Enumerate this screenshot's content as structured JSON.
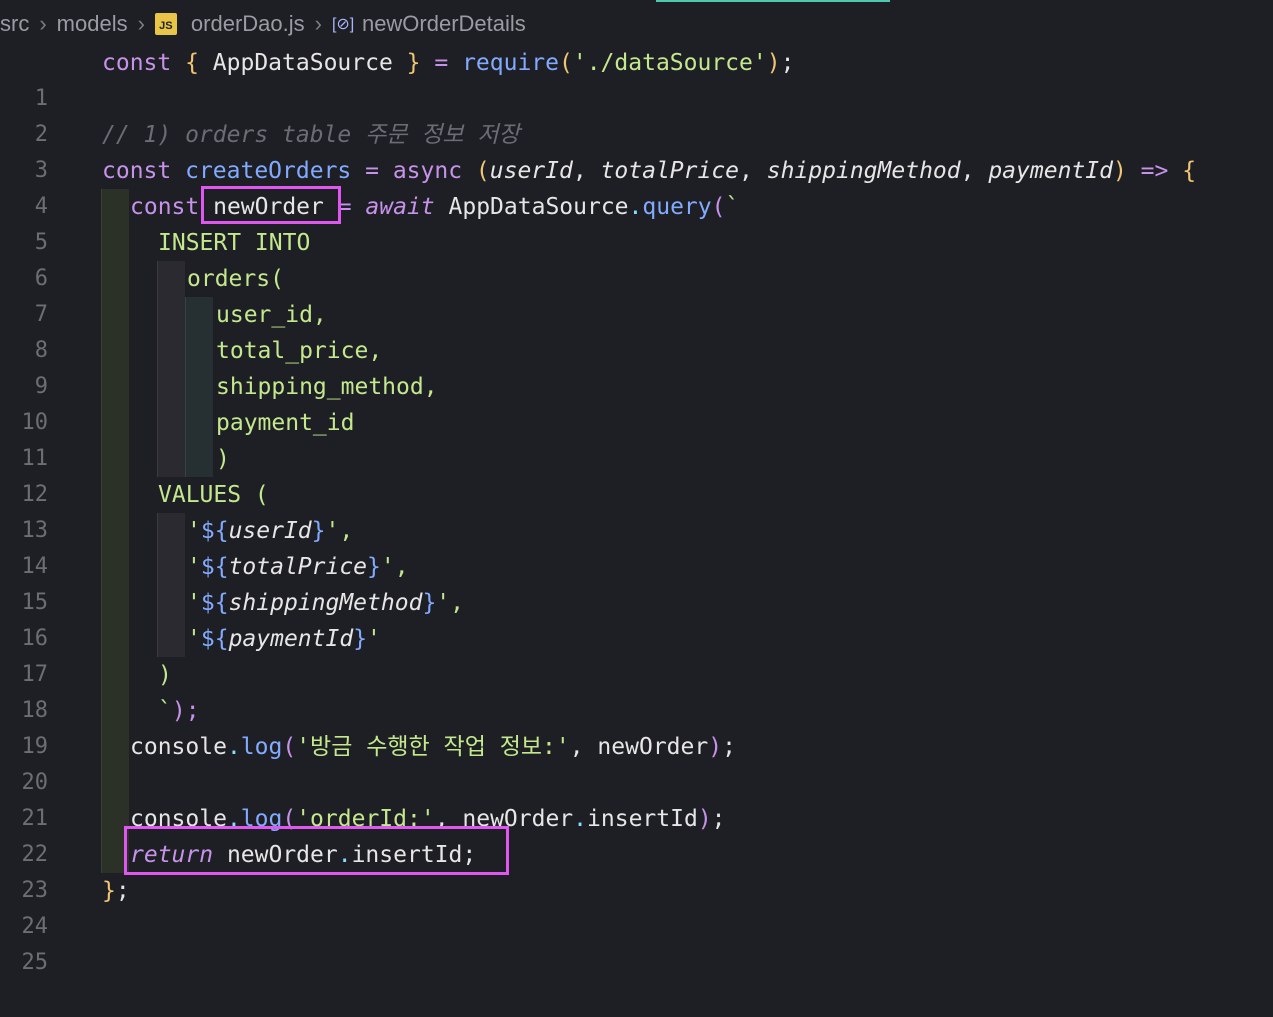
{
  "breadcrumb": {
    "items": [
      "src",
      "models",
      "orderDao.js",
      "newOrderDetails"
    ],
    "file_icon_text": "JS"
  },
  "code": {
    "line_numbers": [
      "1",
      "2",
      "3",
      "4",
      "5",
      "6",
      "7",
      "8",
      "9",
      "10",
      "11",
      "12",
      "13",
      "14",
      "15",
      "16",
      "17",
      "18",
      "19",
      "20",
      "21",
      "22",
      "23",
      "24",
      "25"
    ],
    "l1": {
      "a": "const ",
      "b": "{ ",
      "c": "AppDataSource",
      "d": " }",
      "e": " = ",
      "f": "require",
      "g": "(",
      "h": "'./dataSource'",
      "i": ")",
      "j": ";"
    },
    "l3": "// 1) orders table 주문 정보 저장",
    "l4": {
      "a": "const ",
      "b": "createOrders",
      "c": " = ",
      "d": "async ",
      "e": "(",
      "f": "userId",
      ",": ", ",
      "g": "totalPrice",
      "h": "shippingMethod",
      "i": "paymentId",
      "j": ")",
      "k": " => ",
      "l": "{"
    },
    "l5": {
      "a": "const ",
      "b": "newOrder",
      "c": " = ",
      "d": "await ",
      "e": "AppDataSource",
      "f": ".",
      "g": "query",
      "h": "(",
      "i": "`"
    },
    "l6": "INSERT INTO",
    "l7": "orders(",
    "l8": "user_id,",
    "l9": "total_price,",
    "l10": "shipping_method,",
    "l11": "payment_id",
    "l12": ")",
    "l13": "VALUES (",
    "l14": {
      "q": "'",
      "ds": "${",
      "v": "userId",
      "cb": "}",
      "end": "',"
    },
    "l15": {
      "q": "'",
      "ds": "${",
      "v": "totalPrice",
      "cb": "}",
      "end": "',"
    },
    "l16": {
      "q": "'",
      "ds": "${",
      "v": "shippingMethod",
      "cb": "}",
      "end": "',"
    },
    "l17": {
      "q": "'",
      "ds": "${",
      "v": "paymentId",
      "cb": "}",
      "end": "'"
    },
    "l18": ")",
    "l19": {
      "a": "`",
      "b": ");"
    },
    "l20": {
      "a": "console",
      "b": ".",
      "c": "log",
      "d": "(",
      "e": "'방금 수행한 작업 정보:'",
      "f": ", newOrder",
      "g": ")",
      "h": ";"
    },
    "l22": {
      "a": "console",
      "b": ".",
      "c": "log",
      "d": "(",
      "e": "'orderId:'",
      "f": ", newOrder",
      "g": ".",
      "h": "insertId",
      "i": ")",
      "j": ";"
    },
    "l23": {
      "a": "return ",
      "b": "newOrder",
      "c": ".",
      "d": "insertId",
      "e": ";"
    },
    "l24": {
      "a": "}",
      "b": ";"
    }
  },
  "colors": {
    "keyword": "#c792ea",
    "function": "#82aaff",
    "punctuation": "#f0c674",
    "string": "#c3e88d",
    "comment": "#6a6d76",
    "highlight_box": "#e056f0"
  }
}
